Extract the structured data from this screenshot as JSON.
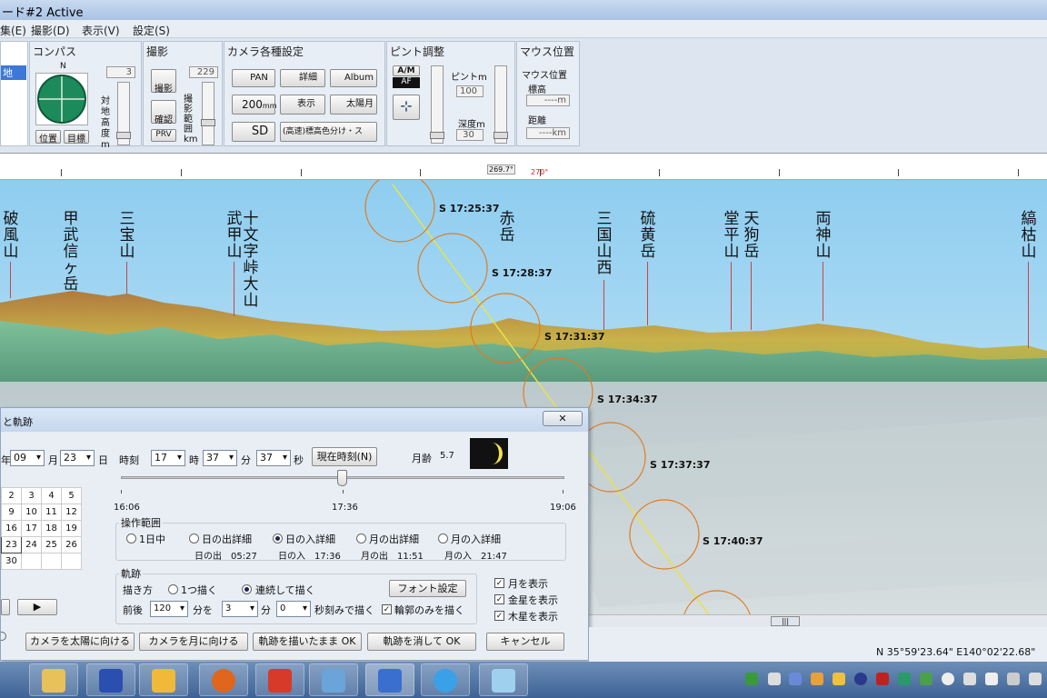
{
  "window": {
    "title": "ード#2 Active"
  },
  "menu": [
    "集(E)",
    "撮影(D)",
    "表示(V)",
    "設定(S)"
  ],
  "ribbon": {
    "left_item": "地",
    "compass": {
      "title": "コンパス",
      "north": "N",
      "height_value": "3",
      "side_label": "対地高度 m",
      "btn_position": "位置",
      "btn_target": "目標"
    },
    "shoot": {
      "title": "撮影",
      "range_value": "229",
      "side_label": "撮影範囲 km",
      "btn_shoot": "撮影",
      "btn_confirm": "確認",
      "btn_prv": "PRV"
    },
    "camera": {
      "title": "カメラ各種設定",
      "pan": "PAN",
      "detail": "詳細",
      "album": "Album",
      "focal": "200",
      "focal_unit": "mm",
      "display": "表示",
      "sun_moon": "太陽月",
      "sd": "SD",
      "speed_option": "(高速)標高色分け・ス"
    },
    "focus": {
      "title": "ピント調整",
      "am": "A/M",
      "af": "AF",
      "focus_label": "ピントm",
      "focus_value": "100",
      "depth_label": "深度m",
      "depth_value": "30"
    },
    "mouse": {
      "title": "マウス位置",
      "subtitle": "マウス位置",
      "elev_label": "標高",
      "elev_value": "----m",
      "dist_label": "距離",
      "dist_value": "----km"
    }
  },
  "ruler": {
    "bearing": "269.7°",
    "mark": "270°"
  },
  "peaks": [
    "破風山",
    "甲武信ヶ岳",
    "三宝山",
    "武甲山",
    "十文字峠大山",
    "赤岳",
    "三国山西",
    "硫黄岳",
    "堂平山",
    "天狗岳",
    "両神山",
    "縞枯山"
  ],
  "sun_track": [
    "S 17:25:37",
    "S 17:28:37",
    "S 17:31:37",
    "S 17:34:37",
    "S 17:37:37",
    "S 17:40:37"
  ],
  "dialog": {
    "title": "と軌跡",
    "year_suffix": "年",
    "month": "09",
    "month_suffix": "月",
    "day": "23",
    "day_suffix": "日",
    "time_label": "時刻",
    "hour": "17",
    "hour_suffix": "時",
    "minute": "37",
    "minute_suffix": "分",
    "second": "37",
    "second_suffix": "秒",
    "now_button": "現在時刻(N)",
    "moon_age_label": "月齢",
    "moon_age": "5.7",
    "slider_start": "16:06",
    "slider_mid": "17:36",
    "slider_end": "19:06",
    "calendar": [
      [
        "2",
        "3",
        "4",
        "5"
      ],
      [
        "9",
        "10",
        "11",
        "12"
      ],
      [
        "16",
        "17",
        "18",
        "19"
      ],
      [
        "23",
        "24",
        "25",
        "26"
      ],
      [
        "30",
        "",
        "",
        ""
      ]
    ],
    "range_title": "操作範囲",
    "range_options": [
      "1日中",
      "日の出詳細",
      "日の入詳細",
      "月の出詳細",
      "月の入詳細"
    ],
    "sunrise": "日の出　05:27",
    "sunset": "日の入　17:36",
    "moonrise": "月の出　11:51",
    "moonset": "月の入　21:47",
    "track_title": "軌跡",
    "draw_label": "描き方",
    "draw_once": "1つ描く",
    "draw_continuous": "連続して描く",
    "font_button": "フォント設定",
    "before_after": "前後",
    "span": "120",
    "span_unit": "分を",
    "step_min": "3",
    "step_unit": "分",
    "step_sec": "0",
    "step_sec_unit": "秒刻みで描く",
    "outline_only": "輪郭のみを描く",
    "show_moon": "月を表示",
    "show_venus": "金星を表示",
    "show_jupiter": "木星を表示",
    "btn_sun": "カメラを太陽に向ける",
    "btn_moon": "カメラを月に向ける",
    "btn_keep": "軌跡を描いたまま OK",
    "btn_clear": "軌跡を消して OK",
    "btn_cancel": "キャンセル"
  },
  "status": {
    "coords": "N 35°59'23.64\"  E140°02'22.68\""
  }
}
